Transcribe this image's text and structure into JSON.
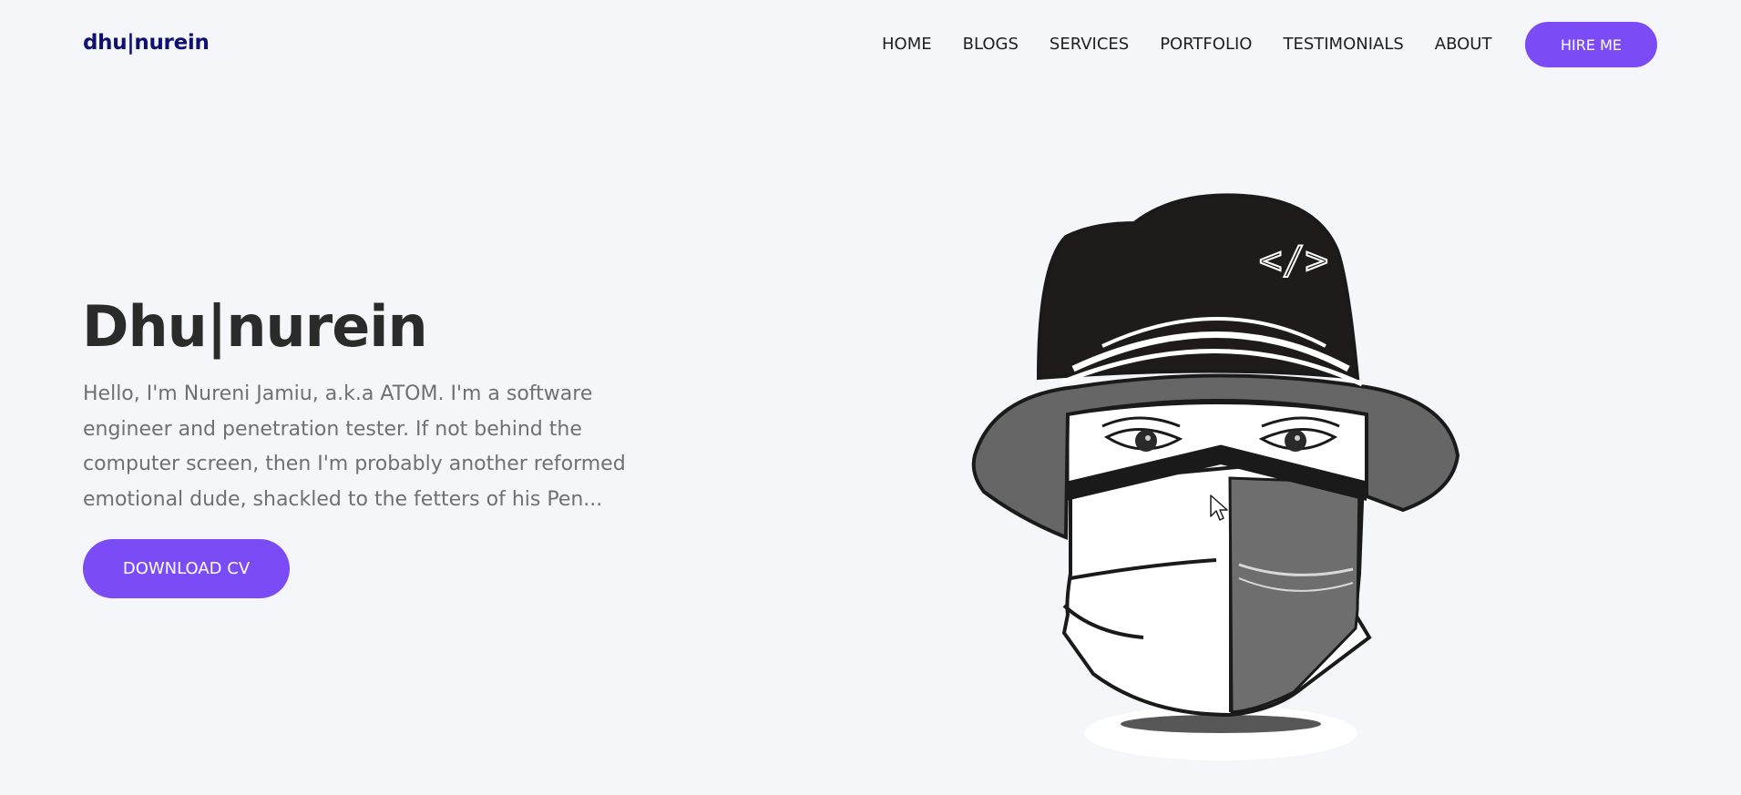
{
  "header": {
    "logo": "dhu|nurein",
    "nav": [
      {
        "label": "HOME"
      },
      {
        "label": "BLOGS"
      },
      {
        "label": "SERVICES"
      },
      {
        "label": "PORTFOLIO"
      },
      {
        "label": "TESTIMONIALS"
      },
      {
        "label": "ABOUT"
      }
    ],
    "hire_label": "HIRE ME"
  },
  "hero": {
    "title": "Dhu|nurein",
    "description": "Hello, I'm Nureni Jamiu, a.k.a ATOM. I'm a software engineer and penetration tester. If not behind the computer screen, then I'm probably another reformed emotional dude, shackled to the fetters of his Pen...",
    "download_label": "DOWNLOAD CV",
    "illustration_icon": "masked-hacker-avatar-icon",
    "cap_logo": "</>"
  },
  "colors": {
    "accent": "#7b4cf5",
    "logo": "#0f1072",
    "background": "#f5f6fa",
    "heading": "#2b2b2b",
    "body_text": "#707070"
  }
}
